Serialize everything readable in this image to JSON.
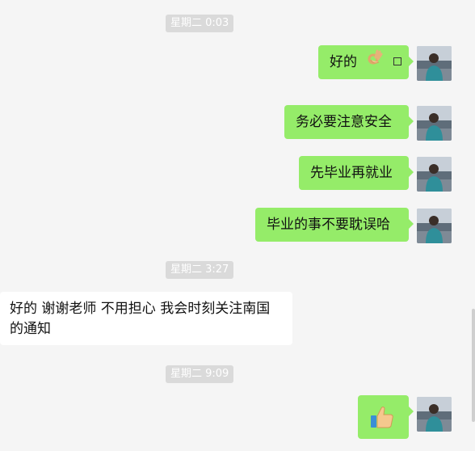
{
  "messages": {
    "ts1": "星期二 0:03",
    "m1": "好的",
    "m2": "务必要注意安全",
    "m3": "先毕业再就业",
    "m4": "毕业的事不要耽误哈",
    "ts2": "星期二 3:27",
    "m5": "好的 谢谢老师 不用担心 我会时刻关注南国的通知",
    "ts3": "星期二 9:09"
  },
  "icons": {
    "ok_hand": "ok-hand-icon",
    "thumbs_up": "thumbs-up-icon",
    "avatar": "avatar"
  },
  "colors": {
    "background": "#f5f5f5",
    "outgoing_bubble": "#95ec69",
    "incoming_bubble": "#ffffff",
    "timestamp_bg": "#dadada",
    "timestamp_text": "#ffffff"
  }
}
